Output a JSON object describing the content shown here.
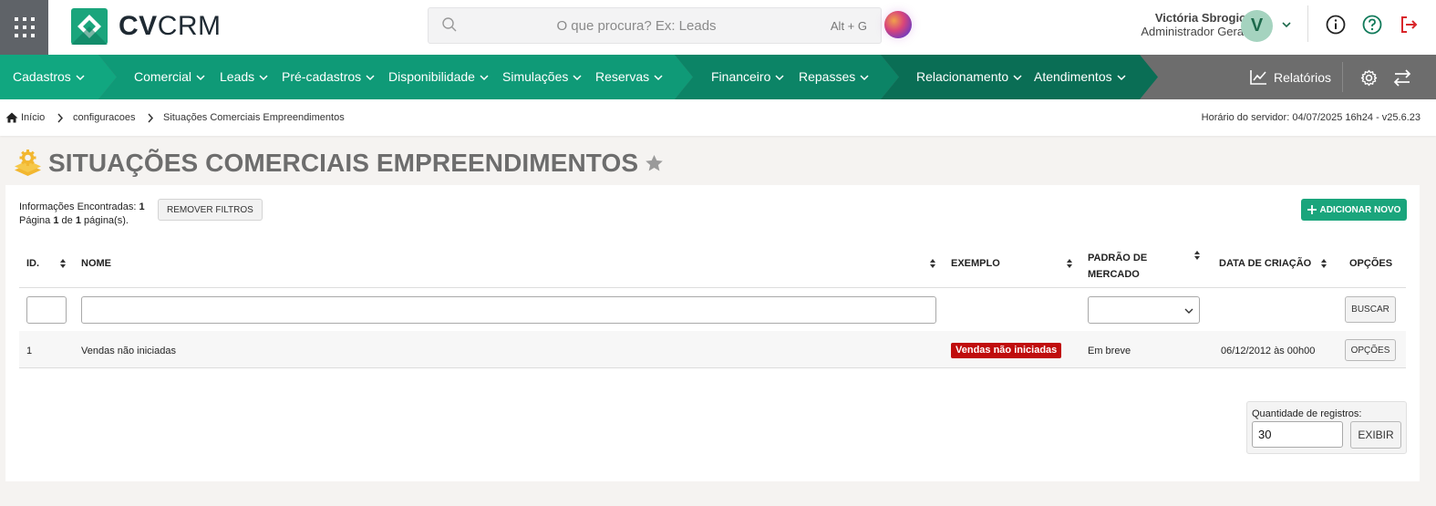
{
  "app": {
    "logo_bold": "CV",
    "logo_light": "CRM"
  },
  "search": {
    "placeholder": "O que procura? Ex: Leads",
    "shortcut": "Alt + G"
  },
  "user": {
    "name": "Victória Sbrogio",
    "role": "Administrador Geral",
    "initial": "V"
  },
  "nav": {
    "items": [
      {
        "label": "Cadastros"
      },
      {
        "label": "Comercial"
      },
      {
        "label": "Leads"
      },
      {
        "label": "Pré-cadastros"
      },
      {
        "label": "Disponibilidade"
      },
      {
        "label": "Simulações"
      },
      {
        "label": "Reservas"
      },
      {
        "label": "Financeiro"
      },
      {
        "label": "Repasses"
      },
      {
        "label": "Relacionamento"
      },
      {
        "label": "Atendimentos"
      }
    ],
    "reports_label": "Relatórios"
  },
  "breadcrumb": {
    "home": "Início",
    "level1": "configuracoes",
    "current": "Situações Comerciais Empreendimentos"
  },
  "server_time": "Horário do servidor: 04/07/2025 16h24 - v25.6.23",
  "page": {
    "title": "SITUAÇÕES COMERCIAIS EMPREENDIMENTOS"
  },
  "summary": {
    "found_label": "Informações Encontradas:",
    "found_count": "1",
    "page_word": "Página",
    "page_current": "1",
    "of_word": "de",
    "page_total": "1",
    "pages_suffix": "página(s).",
    "remove_filters": "REMOVER FILTROS",
    "add_new": "ADICIONAR NOVO"
  },
  "table": {
    "headers": {
      "id": "ID.",
      "name": "NOME",
      "example": "EXEMPLO",
      "market_line1": "PADRÃO DE",
      "market_line2": "MERCADO",
      "created": "DATA DE CRIAÇÃO",
      "options": "OPÇÕES"
    },
    "search_button": "BUSCAR",
    "rows": [
      {
        "id": "1",
        "name": "Vendas não iniciadas",
        "example": "Vendas não iniciadas",
        "market": "Em breve",
        "created": "06/12/2012 às 00h00",
        "options": "OPÇÕES"
      }
    ]
  },
  "pagination": {
    "label": "Quantidade de registros:",
    "value": "30",
    "button": "EXIBIR"
  },
  "colors": {
    "brand_green": "#1aa57c",
    "nav_gray": "#6d6d6d",
    "badge_red": "#c00d0d",
    "logout_red": "#d9262b"
  }
}
